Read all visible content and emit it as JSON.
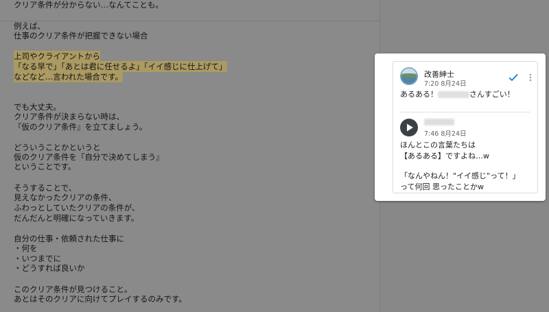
{
  "document": {
    "lines": [
      "クリア条件が分からない…なんてことも。",
      "例えば、",
      "仕事のクリア条件が把握できない場合",
      "上司やクライアントから",
      "「なる早で」「あとは君に任せるよ」「イイ感じに仕上げて」",
      "などなど…言われた場合です。",
      "でも大丈夫。",
      "クリア条件が決まらない時は、",
      "『仮のクリア条件』を立てましょう。",
      "どういうことかというと",
      "仮のクリア条件を『自分で決めてしまう』",
      "ということです。",
      "そうすることで、",
      "見えなかったクリアの条件、",
      "ふわっとしていたクリアの条件が、",
      "だんだんと明確になっていきます。",
      "自分の仕事・依頼された仕事に",
      "・何を",
      "・いつまでに",
      "・どうすれば良いか",
      "このクリア条件が見つけること。",
      "あとはそのクリアに向けてプレイするのみです。"
    ]
  },
  "comment_thread": {
    "comment": {
      "author": "改善紳士",
      "time": "7:20 8月24日",
      "text_before": "あるある！",
      "text_after": "さんすごい！"
    },
    "reply": {
      "time": "7:46 8月24日",
      "text_lines": [
        "ほんとこの言葉たちは",
        "【あるある】ですよね…w",
        "「なんやねん！\"イイ感じ\"って！」",
        "って何回 思ったことかw"
      ]
    },
    "colors": {
      "resolve_check": "#1a73e8",
      "highlight": "#ab9a62"
    },
    "icons": {
      "resolve": "check-icon",
      "more": "more-vert-icon",
      "reply_avatar": "play-circle-icon"
    }
  }
}
